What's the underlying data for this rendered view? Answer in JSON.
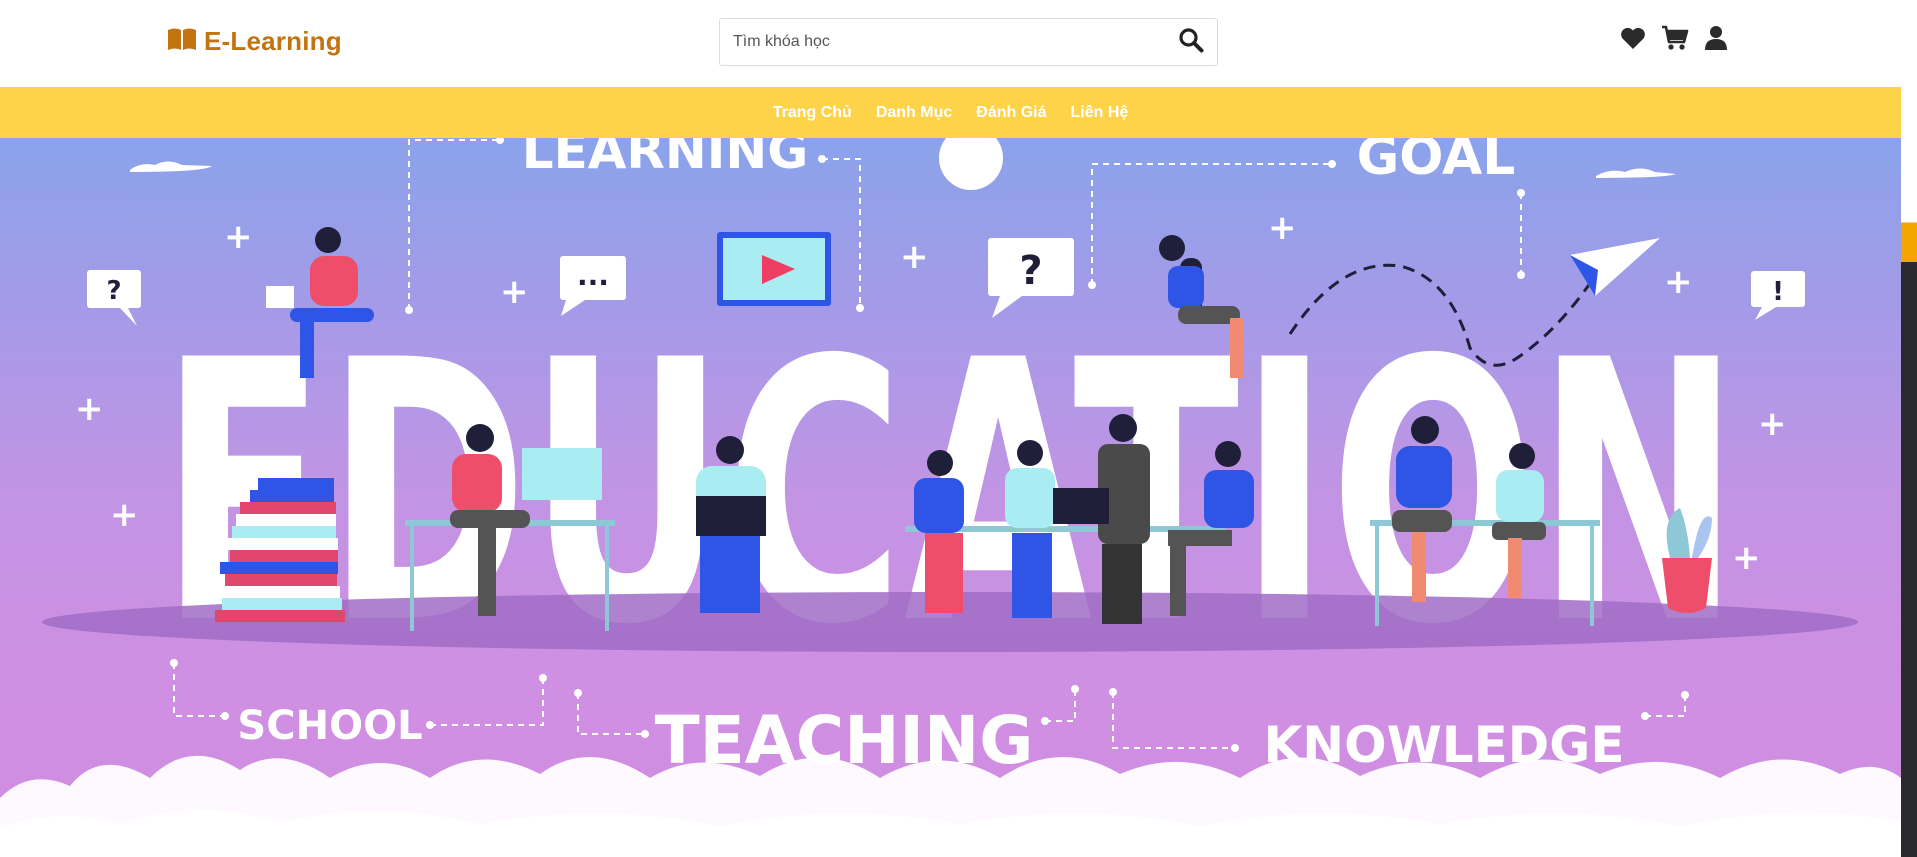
{
  "brand": {
    "name": "E-Learning",
    "icon": "book-icon",
    "color": "#c4740f"
  },
  "search": {
    "placeholder": "Tìm khóa học",
    "value": "",
    "icon": "search-icon"
  },
  "header_actions": [
    {
      "icon": "heart-icon"
    },
    {
      "icon": "cart-icon"
    },
    {
      "icon": "user-icon"
    }
  ],
  "nav": {
    "background": "#fdd34a",
    "items": [
      "Trang Chủ",
      "Danh Mục",
      "Đánh Giá",
      "Liên Hệ"
    ]
  },
  "hero": {
    "words": {
      "learning": "LEARNING",
      "goal": "GOAL",
      "education": "EDUCATION",
      "school": "SCHOOL",
      "teaching": "TEACHING",
      "knowledge": "KNOWLEDGE"
    },
    "bubbles": {
      "question": "?",
      "dots": "...",
      "exclaim": "!"
    }
  }
}
